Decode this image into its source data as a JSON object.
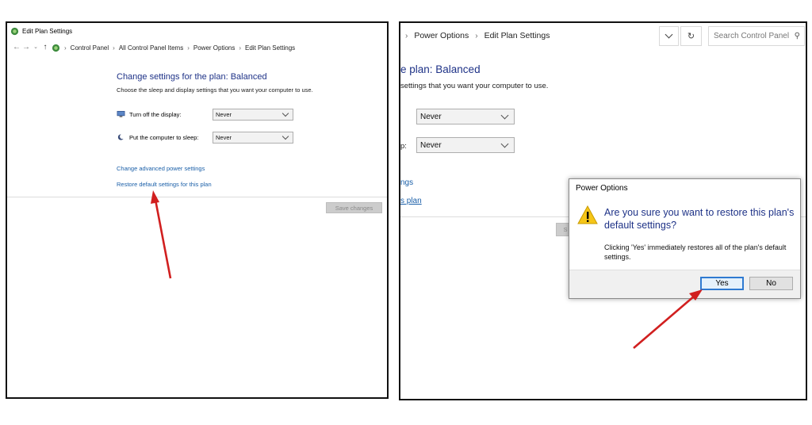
{
  "left": {
    "window_title": "Edit Plan Settings",
    "breadcrumb": [
      "Control Panel",
      "All Control Panel Items",
      "Power Options",
      "Edit Plan Settings"
    ],
    "heading": "Change settings for the plan: Balanced",
    "subtext": "Choose the sleep and display settings that you want your computer to use.",
    "settings": [
      {
        "label": "Turn off the display:",
        "value": "Never",
        "icon": "display-icon"
      },
      {
        "label": "Put the computer to sleep:",
        "value": "Never",
        "icon": "moon-icon"
      }
    ],
    "links": {
      "advanced": "Change advanced power settings",
      "restore": "Restore default settings for this plan"
    },
    "save_button": "Save changes"
  },
  "right": {
    "breadcrumb": [
      "Power Options",
      "Edit Plan Settings"
    ],
    "search_placeholder": "Search Control Panel",
    "heading_partial": "e plan: Balanced",
    "subtext_partial": "settings that you want your computer to use.",
    "select_values": [
      "Never",
      "Never"
    ],
    "sleep_label_partial": "p:",
    "link_partial_1": "ngs",
    "link_partial_2": "s plan",
    "hidden_button_partial": "S",
    "dialog": {
      "title": "Power Options",
      "main_instruction": "Are you sure you want to restore this plan's default settings?",
      "content": "Clicking 'Yes' immediately restores all of the plan's default settings.",
      "yes_label": "Yes",
      "no_label": "No"
    }
  },
  "colors": {
    "heading_blue": "#1e3287",
    "link_blue": "#1a5fa8",
    "arrow_red": "#d11f1f",
    "warning_yellow": "#f5c518"
  }
}
